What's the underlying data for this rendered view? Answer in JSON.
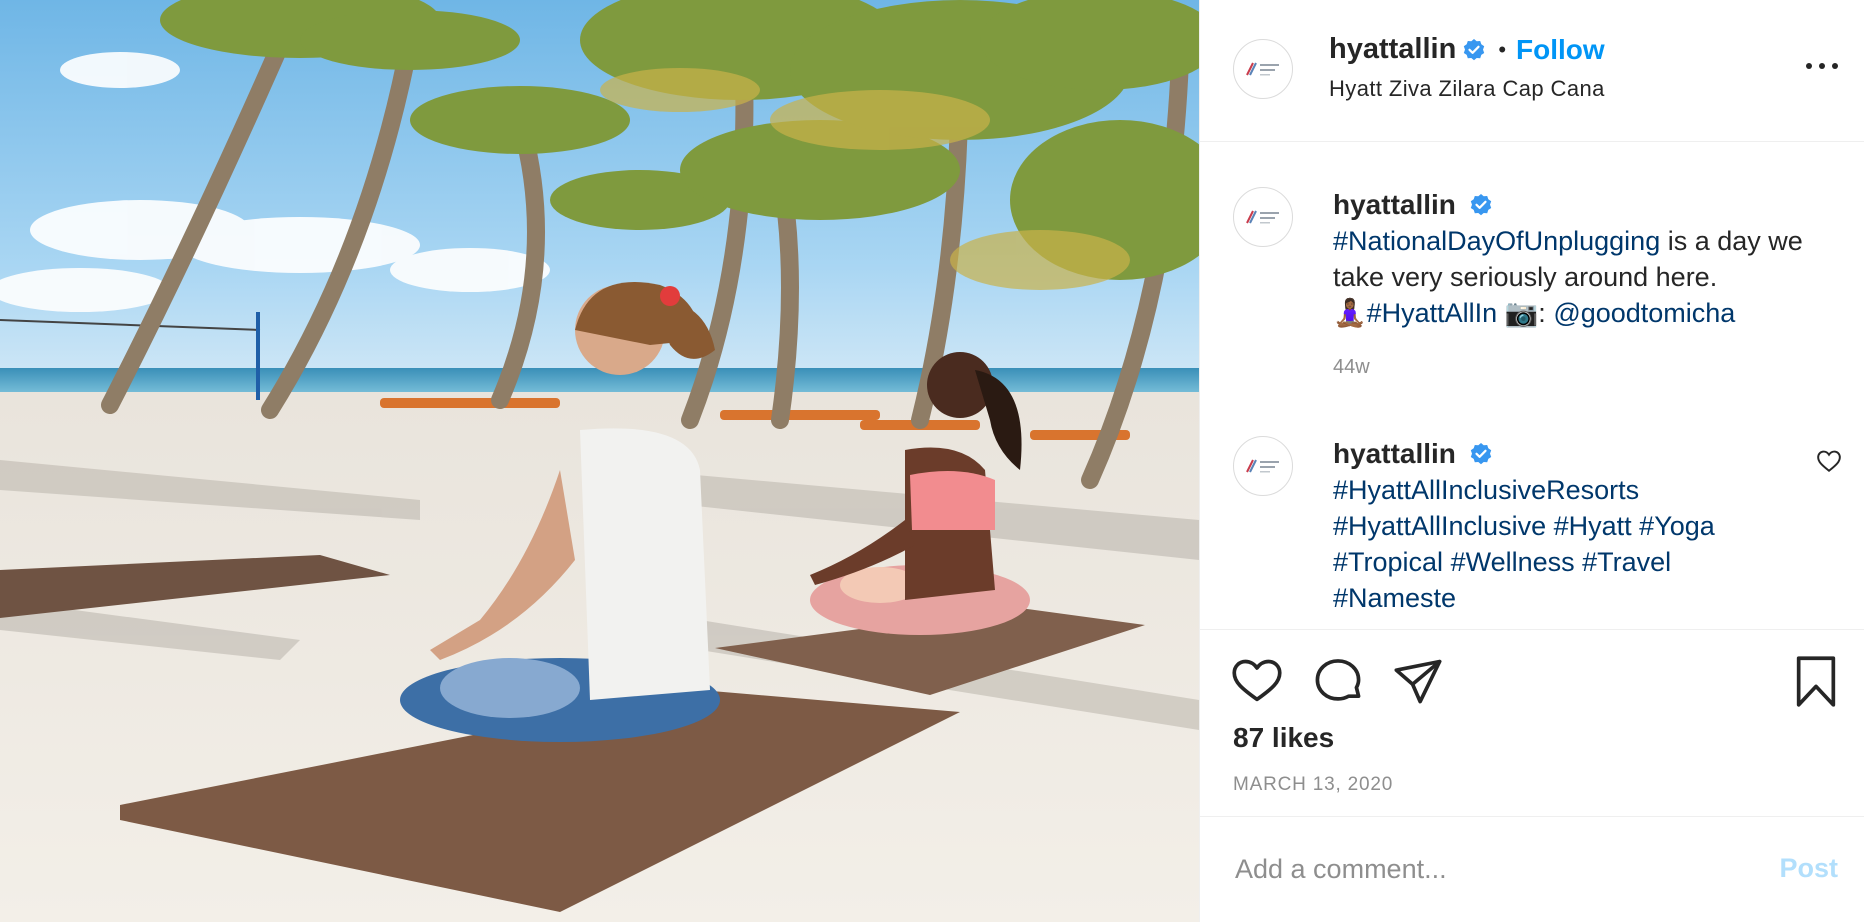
{
  "post": {
    "username": "hyattallin",
    "verified_icon": "verified-badge-icon",
    "follow_label": "Follow",
    "separator": "•",
    "location": "Hyatt Ziva Zilara Cap Cana",
    "more_icon": "more-options-icon"
  },
  "comments": [
    {
      "username": "hyattallin",
      "segments": [
        {
          "text": "#NationalDayOfUnplugging",
          "link": true
        },
        {
          "text": " is a day we take very seriously around here. ",
          "link": false
        },
        {
          "text": "🧘🏾‍♀️",
          "link": false
        },
        {
          "text": "#HyattAllIn",
          "link": true
        },
        {
          "text": " 📷: ",
          "link": false
        },
        {
          "text": "@goodtomicha",
          "link": true
        }
      ],
      "time": "44w"
    },
    {
      "username": "hyattallin",
      "segments": [
        {
          "text": "#HyattAllInclusiveResorts",
          "link": true
        },
        {
          "text": " ",
          "link": false
        },
        {
          "text": "#HyattAllInclusive",
          "link": true
        },
        {
          "text": " ",
          "link": false
        },
        {
          "text": "#Hyatt",
          "link": true
        },
        {
          "text": " ",
          "link": false
        },
        {
          "text": "#Yoga",
          "link": true
        },
        {
          "text": " ",
          "link": false
        },
        {
          "text": "#Tropical",
          "link": true
        },
        {
          "text": " ",
          "link": false
        },
        {
          "text": "#Wellness",
          "link": true
        },
        {
          "text": " ",
          "link": false
        },
        {
          "text": "#Travel",
          "link": true
        },
        {
          "text": " ",
          "link": false
        },
        {
          "text": "#Nameste",
          "link": true
        }
      ]
    }
  ],
  "actions": {
    "like_icon": "heart-icon",
    "comment_icon": "comment-bubble-icon",
    "share_icon": "paper-plane-icon",
    "save_icon": "bookmark-icon"
  },
  "likes": "87 likes",
  "date": "MARCH 13, 2020",
  "add_comment": {
    "placeholder": "Add a comment...",
    "post_label": "Post"
  },
  "colors": {
    "accent": "#0095f6",
    "link": "#00376b",
    "muted": "#8e8e8e",
    "post_disabled": "#b2dffc",
    "border": "#efefef"
  }
}
